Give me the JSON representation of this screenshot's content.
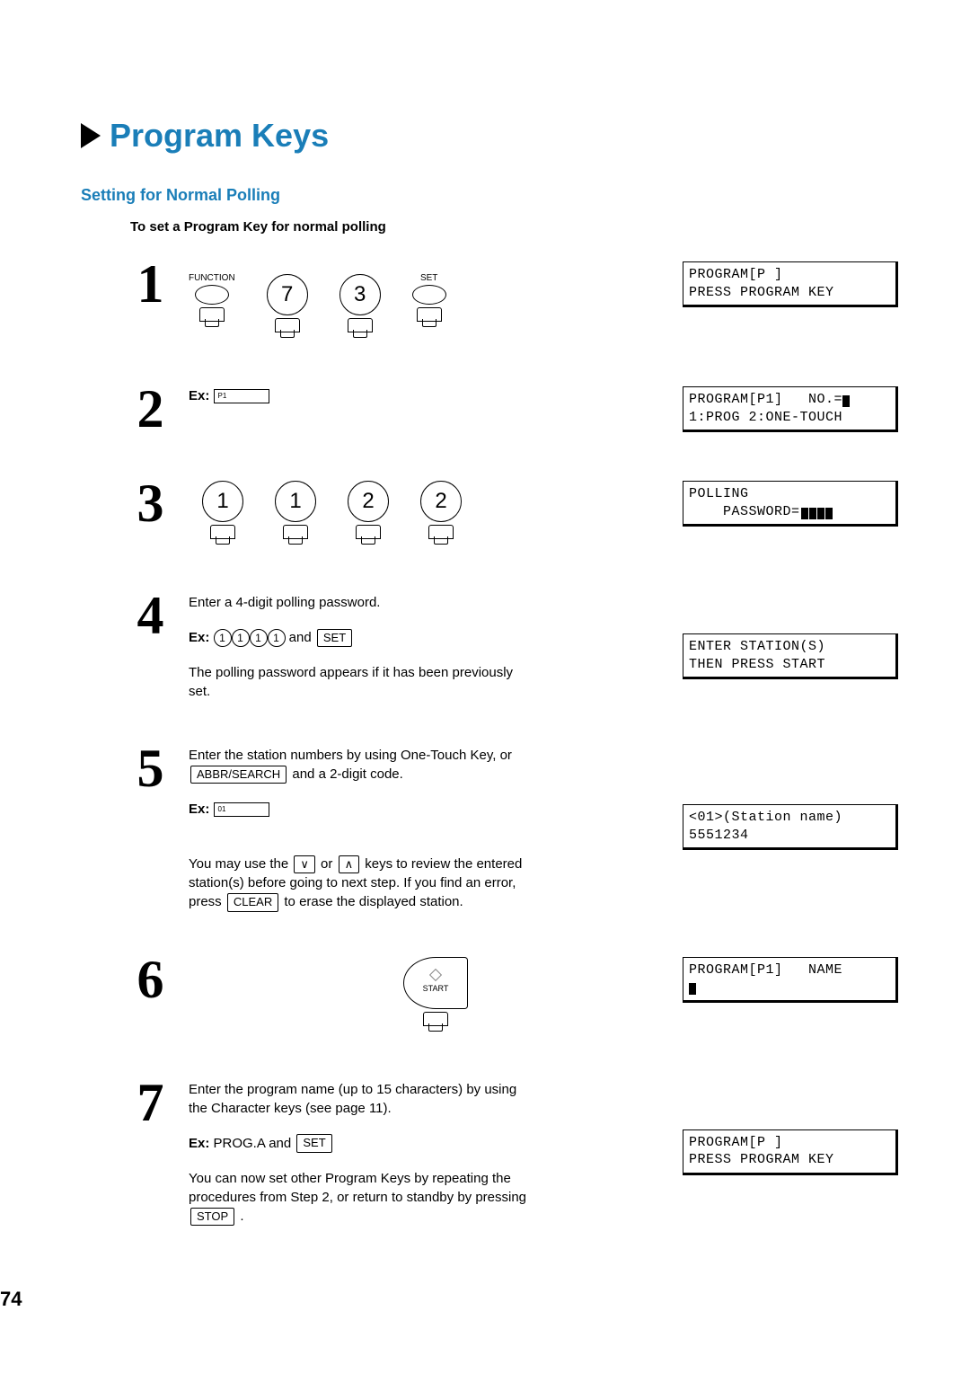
{
  "header": {
    "title": "Program Keys"
  },
  "subsection": {
    "title": "Setting for Normal Polling",
    "instruction": "To set a Program Key for normal polling"
  },
  "steps": {
    "s1": {
      "num": "1",
      "key_function": "FUNCTION",
      "key_7": "7",
      "key_3": "3",
      "key_set": "SET",
      "display_line1": "PROGRAM[P ]",
      "display_line2": "PRESS PROGRAM KEY"
    },
    "s2": {
      "num": "2",
      "ex_label": "Ex:",
      "ex_value": "P1",
      "display_line1": "PROGRAM[P1]   NO.=",
      "display_line2": "1:PROG 2:ONE-TOUCH"
    },
    "s3": {
      "num": "3",
      "key_1": "1",
      "key_1b": "1",
      "key_2": "2",
      "key_2b": "2",
      "display_line1": "POLLING",
      "display_line2": "    PASSWORD="
    },
    "s4": {
      "num": "4",
      "line1": "Enter a 4-digit polling password.",
      "ex_label": "Ex:",
      "ex_digits": [
        "1",
        "1",
        "1",
        "1"
      ],
      "ex_and": " and ",
      "ex_set": "SET",
      "line2": "The polling password appears if it has been previously set.",
      "display_line1": "ENTER STATION(S)",
      "display_line2": "THEN PRESS START"
    },
    "s5": {
      "num": "5",
      "line1a": "Enter the station numbers by using One-Touch Key, or ",
      "abbr_key": "ABBR/SEARCH",
      "line1b": " and a 2-digit code.",
      "ex_label": "Ex:",
      "ex_value": "01",
      "line2a": "You may use the ",
      "down_key": "∨",
      "line2b": " or ",
      "up_key": "∧",
      "line2c": " keys to review the entered station(s) before going to next step. If you find an error, press ",
      "clear_key": "CLEAR",
      "line2d": " to erase the displayed station.",
      "display_line1": "<01>(Station name)",
      "display_line2": "5551234"
    },
    "s6": {
      "num": "6",
      "start_label": "START",
      "display_line1": "PROGRAM[P1]   NAME"
    },
    "s7": {
      "num": "7",
      "line1": "Enter the program name (up to 15 characters) by using the Character keys (see page 11).",
      "ex_label": "Ex:",
      "ex_value": " PROG.A and ",
      "ex_set": "SET",
      "line2a": "You can now set other Program Keys by repeating the procedures from Step 2, or return to standby by pressing ",
      "stop_key": "STOP",
      "line2b": " .",
      "display_line1": "PROGRAM[P ]",
      "display_line2": "PRESS PROGRAM KEY"
    }
  },
  "page_number": "74"
}
